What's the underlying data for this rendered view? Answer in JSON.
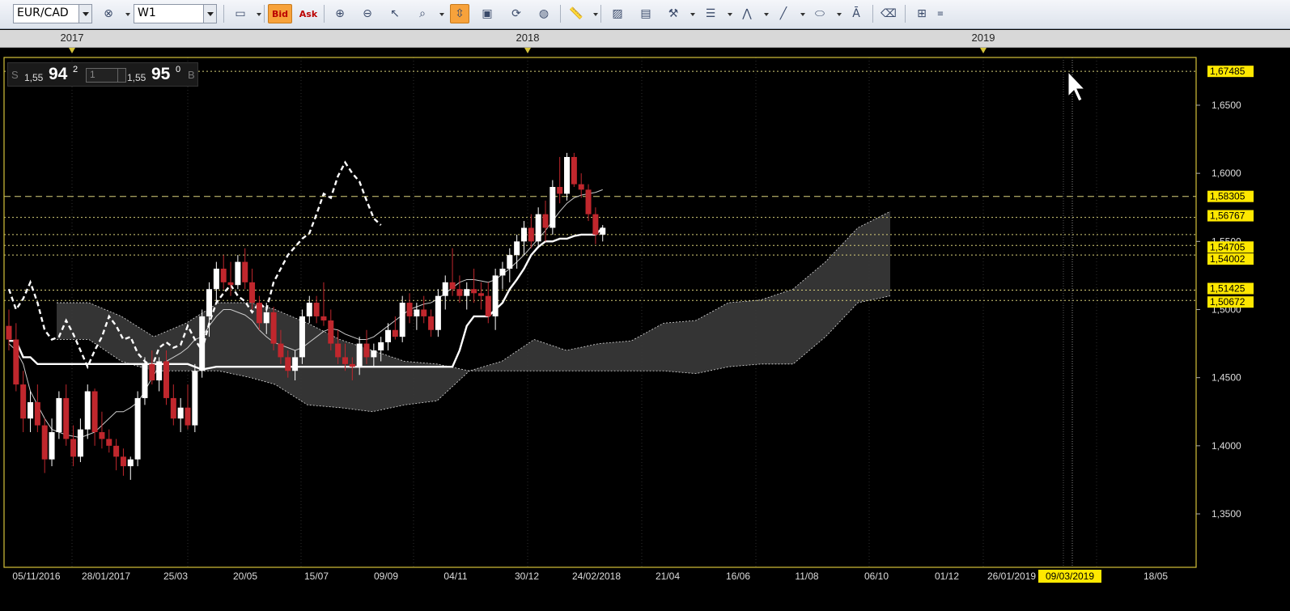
{
  "toolbar": {
    "symbol": "EUR/CAD",
    "timeframe": "W1",
    "bid_label": "Bid",
    "ask_label": "Ask"
  },
  "years": [
    "2017",
    "2018",
    "2019"
  ],
  "quote": {
    "sell_side": "S",
    "sell_small": "1,55",
    "sell_big": "94",
    "sell_sup": "2",
    "lot": "1",
    "buy_small": "1,55",
    "buy_big": "95",
    "buy_sup": "0",
    "buy_side": "B"
  },
  "colors": {
    "background": "#000000",
    "frame": "#d4c23a",
    "bull": "#ffffff",
    "bear": "#c0272d",
    "cloud": "#3a3a3a",
    "price_tag": "#ffe800",
    "active_tool": "#f7a23b"
  },
  "chart_data": {
    "type": "candlestick",
    "symbol": "EUR/CAD",
    "timeframe": "W1",
    "y_ticks": [
      "1,6500",
      "1,6000",
      "1,5500",
      "1,5000",
      "1,4500",
      "1,4000",
      "1,3500"
    ],
    "y_range": [
      1.305,
      1.68
    ],
    "price_tags": [
      "1,67485",
      "1,58305",
      "1,56767",
      "1,54705",
      "1,54002",
      "1,51425",
      "1,50672"
    ],
    "x_ticks": [
      "05/11/2016",
      "28/01/2017",
      "25/03",
      "20/05",
      "15/07",
      "09/09",
      "04/11",
      "30/12",
      "24/02/2018",
      "21/04",
      "16/06",
      "11/08",
      "06/10",
      "01/12",
      "26/01/2019",
      "09/03/2019",
      "18/05"
    ],
    "highlighted_x_tick": "09/03/2019",
    "candles_ohlc": [
      [
        1.488,
        1.5,
        1.47,
        1.478
      ],
      [
        1.478,
        1.49,
        1.44,
        1.445
      ],
      [
        1.445,
        1.455,
        1.41,
        1.42
      ],
      [
        1.42,
        1.44,
        1.41,
        1.432
      ],
      [
        1.432,
        1.445,
        1.41,
        1.415
      ],
      [
        1.415,
        1.42,
        1.38,
        1.39
      ],
      [
        1.39,
        1.42,
        1.385,
        1.41
      ],
      [
        1.41,
        1.44,
        1.405,
        1.435
      ],
      [
        1.435,
        1.445,
        1.4,
        1.405
      ],
      [
        1.405,
        1.415,
        1.385,
        1.392
      ],
      [
        1.392,
        1.42,
        1.388,
        1.412
      ],
      [
        1.412,
        1.445,
        1.405,
        1.44
      ],
      [
        1.44,
        1.442,
        1.4,
        1.41
      ],
      [
        1.41,
        1.425,
        1.398,
        1.405
      ],
      [
        1.405,
        1.412,
        1.395,
        1.4
      ],
      [
        1.4,
        1.405,
        1.382,
        1.392
      ],
      [
        1.392,
        1.398,
        1.378,
        1.385
      ],
      [
        1.385,
        1.392,
        1.375,
        1.39
      ],
      [
        1.39,
        1.44,
        1.385,
        1.435
      ],
      [
        1.435,
        1.465,
        1.43,
        1.46
      ],
      [
        1.46,
        1.47,
        1.445,
        1.448
      ],
      [
        1.448,
        1.465,
        1.44,
        1.462
      ],
      [
        1.462,
        1.47,
        1.43,
        1.435
      ],
      [
        1.435,
        1.445,
        1.415,
        1.42
      ],
      [
        1.42,
        1.435,
        1.41,
        1.428
      ],
      [
        1.428,
        1.445,
        1.412,
        1.415
      ],
      [
        1.415,
        1.46,
        1.41,
        1.455
      ],
      [
        1.455,
        1.5,
        1.45,
        1.495
      ],
      [
        1.495,
        1.52,
        1.48,
        1.515
      ],
      [
        1.515,
        1.535,
        1.505,
        1.53
      ],
      [
        1.53,
        1.54,
        1.515,
        1.52
      ],
      [
        1.52,
        1.535,
        1.51,
        1.518
      ],
      [
        1.518,
        1.54,
        1.515,
        1.535
      ],
      [
        1.535,
        1.545,
        1.515,
        1.52
      ],
      [
        1.52,
        1.53,
        1.5,
        1.505
      ],
      [
        1.505,
        1.51,
        1.485,
        1.49
      ],
      [
        1.49,
        1.505,
        1.482,
        1.498
      ],
      [
        1.498,
        1.502,
        1.47,
        1.475
      ],
      [
        1.475,
        1.485,
        1.46,
        1.465
      ],
      [
        1.465,
        1.47,
        1.45,
        1.455
      ],
      [
        1.455,
        1.47,
        1.448,
        1.465
      ],
      [
        1.465,
        1.5,
        1.46,
        1.495
      ],
      [
        1.495,
        1.51,
        1.49,
        1.505
      ],
      [
        1.505,
        1.51,
        1.49,
        1.495
      ],
      [
        1.495,
        1.52,
        1.488,
        1.492
      ],
      [
        1.492,
        1.5,
        1.47,
        1.475
      ],
      [
        1.475,
        1.485,
        1.46,
        1.465
      ],
      [
        1.465,
        1.475,
        1.455,
        1.46
      ],
      [
        1.46,
        1.465,
        1.448,
        1.458
      ],
      [
        1.458,
        1.48,
        1.452,
        1.475
      ],
      [
        1.475,
        1.485,
        1.46,
        1.465
      ],
      [
        1.465,
        1.475,
        1.458,
        1.47
      ],
      [
        1.47,
        1.48,
        1.462,
        1.476
      ],
      [
        1.476,
        1.49,
        1.47,
        1.485
      ],
      [
        1.485,
        1.495,
        1.478,
        1.48
      ],
      [
        1.48,
        1.51,
        1.476,
        1.505
      ],
      [
        1.505,
        1.512,
        1.49,
        1.495
      ],
      [
        1.495,
        1.505,
        1.485,
        1.5
      ],
      [
        1.5,
        1.51,
        1.49,
        1.495
      ],
      [
        1.495,
        1.5,
        1.48,
        1.485
      ],
      [
        1.485,
        1.515,
        1.48,
        1.51
      ],
      [
        1.51,
        1.525,
        1.5,
        1.52
      ],
      [
        1.52,
        1.545,
        1.51,
        1.515
      ],
      [
        1.515,
        1.525,
        1.505,
        1.51
      ],
      [
        1.51,
        1.52,
        1.5,
        1.515
      ],
      [
        1.515,
        1.53,
        1.505,
        1.512
      ],
      [
        1.512,
        1.52,
        1.5,
        1.51
      ],
      [
        1.51,
        1.52,
        1.49,
        1.495
      ],
      [
        1.495,
        1.53,
        1.485,
        1.525
      ],
      [
        1.525,
        1.535,
        1.515,
        1.53
      ],
      [
        1.53,
        1.545,
        1.52,
        1.54
      ],
      [
        1.54,
        1.555,
        1.53,
        1.55
      ],
      [
        1.55,
        1.565,
        1.54,
        1.56
      ],
      [
        1.56,
        1.57,
        1.545,
        1.55
      ],
      [
        1.55,
        1.575,
        1.545,
        1.57
      ],
      [
        1.57,
        1.58,
        1.55,
        1.56
      ],
      [
        1.56,
        1.595,
        1.555,
        1.59
      ],
      [
        1.59,
        1.612,
        1.578,
        1.585
      ],
      [
        1.585,
        1.615,
        1.58,
        1.612
      ],
      [
        1.612,
        1.615,
        1.59,
        1.592
      ],
      [
        1.592,
        1.6,
        1.582,
        1.588
      ],
      [
        1.588,
        1.592,
        1.565,
        1.57
      ],
      [
        1.57,
        1.575,
        1.548,
        1.555
      ],
      [
        1.555,
        1.562,
        1.55,
        1.56
      ]
    ],
    "ichimoku": {
      "tenkan": [
        1.475,
        1.47,
        1.46,
        1.44,
        1.43,
        1.42,
        1.412,
        1.41,
        1.408,
        1.407,
        1.406,
        1.408,
        1.41,
        1.415,
        1.42,
        1.425,
        1.425,
        1.428,
        1.432,
        1.44,
        1.45,
        1.458,
        1.462,
        1.465,
        1.468,
        1.472,
        1.478,
        1.48,
        1.488,
        1.495,
        1.5,
        1.5,
        1.498,
        1.496,
        1.492,
        1.485,
        1.48,
        1.476,
        1.474,
        1.472,
        1.47,
        1.472,
        1.476,
        1.48,
        1.484,
        1.486,
        1.485,
        1.482,
        1.48,
        1.478,
        1.478,
        1.48,
        1.484,
        1.488,
        1.492,
        1.496,
        1.5,
        1.502,
        1.504,
        1.505,
        1.508,
        1.512,
        1.516,
        1.52,
        1.522,
        1.522,
        1.521,
        1.52,
        1.522,
        1.526,
        1.53,
        1.535,
        1.54,
        1.546,
        1.552,
        1.558,
        1.565,
        1.572,
        1.578,
        1.582,
        1.584,
        1.585,
        1.586,
        1.588
      ],
      "kijun": [
        1.477,
        1.477,
        1.465,
        1.465,
        1.46,
        1.46,
        1.46,
        1.46,
        1.46,
        1.46,
        1.46,
        1.46,
        1.46,
        1.46,
        1.46,
        1.46,
        1.46,
        1.46,
        1.46,
        1.46,
        1.46,
        1.46,
        1.46,
        1.46,
        1.46,
        1.46,
        1.458,
        1.456,
        1.457,
        1.458,
        1.458,
        1.458,
        1.458,
        1.458,
        1.458,
        1.458,
        1.458,
        1.458,
        1.458,
        1.458,
        1.458,
        1.458,
        1.458,
        1.458,
        1.458,
        1.458,
        1.458,
        1.458,
        1.458,
        1.458,
        1.458,
        1.458,
        1.458,
        1.458,
        1.458,
        1.458,
        1.458,
        1.458,
        1.458,
        1.458,
        1.458,
        1.458,
        1.458,
        1.47,
        1.488,
        1.495,
        1.495,
        1.495,
        1.5,
        1.505,
        1.515,
        1.522,
        1.53,
        1.54,
        1.546,
        1.55,
        1.55,
        1.552,
        1.552,
        1.554,
        1.555,
        1.555,
        1.555,
        1.56
      ],
      "chikou": [
        1.515,
        1.5,
        1.508,
        1.52,
        1.505,
        1.485,
        1.478,
        1.48,
        1.492,
        1.482,
        1.47,
        1.458,
        1.47,
        1.48,
        1.495,
        1.488,
        1.478,
        1.48,
        1.468,
        1.462,
        1.458,
        1.472,
        1.476,
        1.472,
        1.474,
        1.488,
        1.478,
        1.47,
        1.49,
        1.505,
        1.512,
        1.518,
        1.51,
        1.506,
        1.498,
        1.505,
        1.5,
        1.52,
        1.53,
        1.54,
        1.546,
        1.552,
        1.556,
        1.57,
        1.585,
        1.582,
        1.598,
        1.608,
        1.6,
        1.594,
        1.58,
        1.567,
        1.562
      ]
    }
  }
}
